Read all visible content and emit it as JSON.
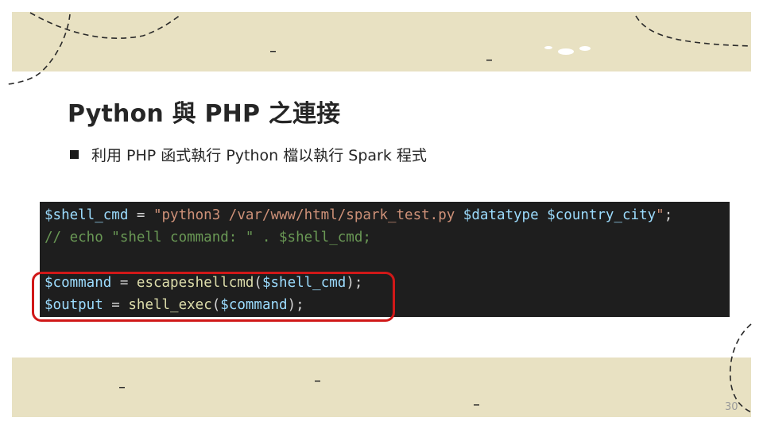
{
  "slide": {
    "title": "Python 與 PHP 之連接",
    "bullet": "利用 PHP 函式執行 Python 檔以執行 Spark 程式",
    "page_number": "30",
    "band_color": "#e8e1c2",
    "highlight_color": "#d01818"
  },
  "code": {
    "lines": [
      {
        "kind": "assign",
        "var": "$shell_cmd",
        "op": " = ",
        "str1": "\"python3 /var/www/html/spark_test.py ",
        "var2": "$datatype",
        "sp": " ",
        "var3": "$country_city",
        "str2": "\"",
        "end": ";"
      },
      {
        "kind": "comment",
        "text": "// echo \"shell command: \" . $shell_cmd;"
      },
      {
        "kind": "blank"
      },
      {
        "kind": "call",
        "var": "$command",
        "op": " = ",
        "fn": "escapeshellcmd",
        "open": "(",
        "arg": "$shell_cmd",
        "close": ");"
      },
      {
        "kind": "call",
        "var": "$output",
        "op": " = ",
        "fn": "shell_exec",
        "open": "(",
        "arg": "$command",
        "close": ");"
      }
    ]
  }
}
